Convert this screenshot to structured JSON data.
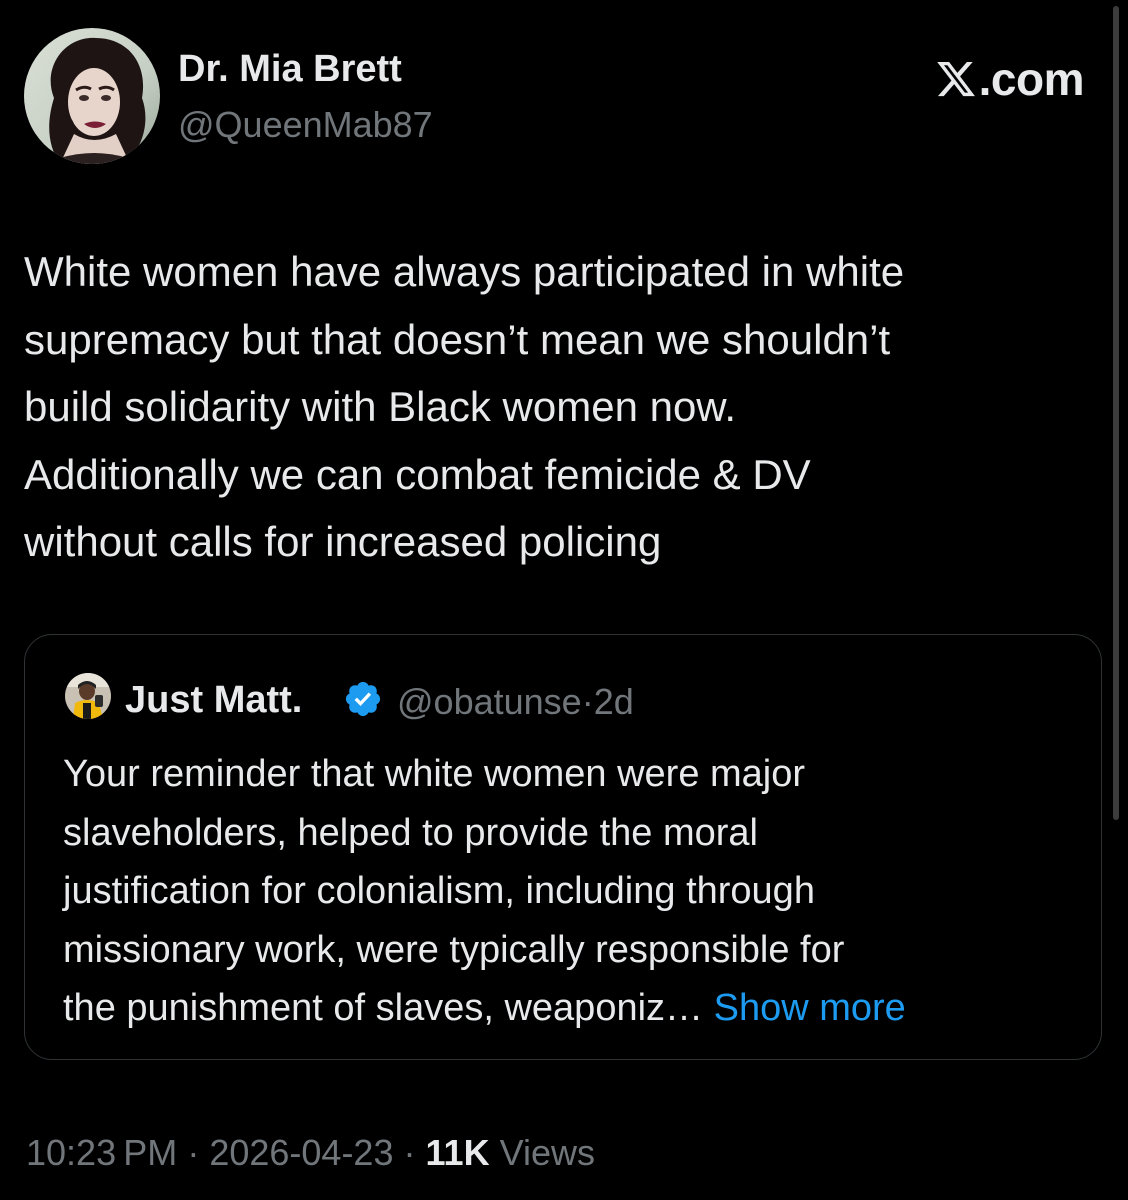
{
  "author": {
    "display_name": "Dr. Mia Brett",
    "handle": "@QueenMab87"
  },
  "brand": {
    "label": ".com",
    "icon": "x-logo-icon"
  },
  "tweet": {
    "lines": [
      "White women have always participated in white",
      "supremacy but that doesn’t mean we shouldn’t",
      "build solidarity with Black women now.",
      "Additionally we can combat femicide & DV",
      "without calls for increased policing"
    ]
  },
  "quote": {
    "display_name": "Just Matt.",
    "verified_icon": "verified-badge-icon",
    "handle": "@obatunse",
    "separator": "·",
    "age": "2d",
    "lines": [
      "Your reminder that white women were major",
      "slaveholders, helped to provide the moral",
      "justification for colonialism, including through",
      "missionary work, were typically responsible for",
      "the punishment of slaves, weaponiz…"
    ],
    "show_more": "Show more"
  },
  "footer": {
    "time": "10:23 PM",
    "sep1": "·",
    "date": "2026-04-23",
    "sep2": "·",
    "views_count": "11K",
    "views_label": "Views"
  },
  "colors": {
    "background": "#000000",
    "text_primary": "#e7e9ea",
    "text_secondary": "#71767b",
    "link": "#1d9bf0",
    "border": "#2f3336"
  }
}
